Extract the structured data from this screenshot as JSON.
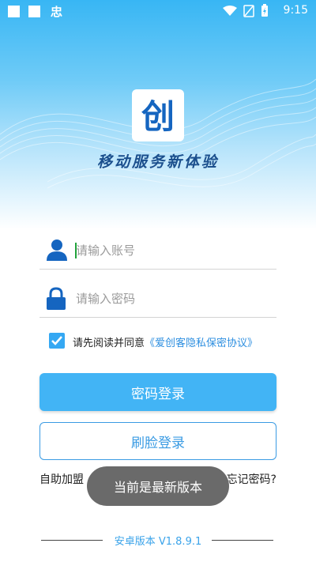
{
  "status_bar": {
    "time": "9:15",
    "carrier_glyph": "忠",
    "icons": [
      "wifi-icon",
      "no-sim-icon",
      "battery-charging-icon"
    ]
  },
  "branding": {
    "logo_char": "创",
    "slogan": "移动服务新体验"
  },
  "form": {
    "account_placeholder": "请输入账号",
    "password_placeholder": "请输入密码",
    "agreement_checked": true,
    "agreement_text": "请先阅读并同意",
    "agreement_link": "《爱创客隐私保密协议》",
    "login_password_label": "密码登录",
    "login_face_label": "刷脸登录"
  },
  "links": {
    "left": "自助加盟",
    "right": "忘记密码?"
  },
  "toast": "当前是最新版本",
  "footer": {
    "version": "安卓版本 V1.8.9.1"
  },
  "colors": {
    "primary": "#42b4f5",
    "link": "#2e8fe0",
    "icon": "#1565c0",
    "slogan": "#1b4f8d"
  }
}
